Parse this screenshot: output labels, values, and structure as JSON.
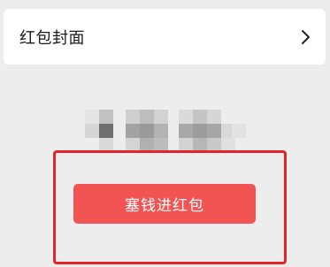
{
  "cover_row": {
    "label": "红包封面",
    "chevron_icon": "chevron-right-icon"
  },
  "amount": {
    "icon": "pixelated-amount"
  },
  "send_button": {
    "label": "塞钱进红包",
    "color": "#f25454"
  },
  "highlight": {
    "color": "#e6232b"
  }
}
